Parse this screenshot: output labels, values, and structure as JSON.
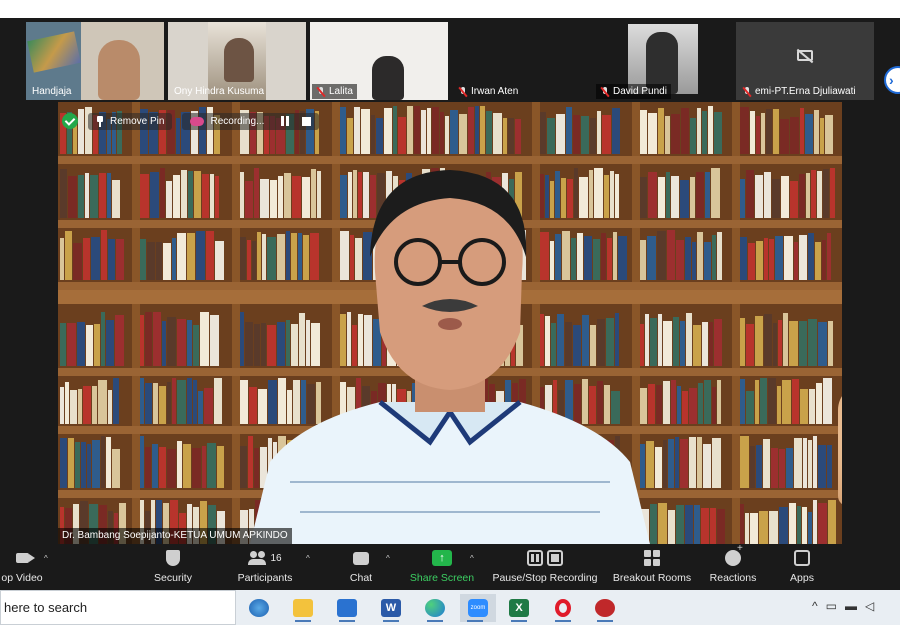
{
  "colors": {
    "zoom_bg": "#1a1a1a",
    "share_green": "#23b64b",
    "accent_blue": "#1f6ad6",
    "mute_red": "#e02828",
    "taskbar_bg": "#e9eef3"
  },
  "gallery": {
    "participants": [
      {
        "name": "Handjaja",
        "muted": false
      },
      {
        "name": "Ony Hindra Kusuma",
        "muted": false
      },
      {
        "name": "Lalita",
        "muted": true
      },
      {
        "name": "Irwan Aten",
        "muted": true
      },
      {
        "name": "David Pundi",
        "muted": true
      },
      {
        "name": "emi-PT.Erna Djuliawati",
        "muted": true,
        "video_off": true
      }
    ],
    "next_icon": "chevron-right-icon"
  },
  "overlay": {
    "remove_pin_label": "Remove Pin",
    "recording_label": "Recording..."
  },
  "speaker": {
    "name_tag": "Dr. Bambang Soepijanto-KETUA UMUM APKINDO"
  },
  "toolbar": {
    "stop_video": "op Video",
    "security": "Security",
    "participants": "Participants",
    "participants_count": "16",
    "chat": "Chat",
    "share_screen": "Share Screen",
    "pause_stop_recording": "Pause/Stop Recording",
    "breakout_rooms": "Breakout Rooms",
    "reactions": "Reactions",
    "apps": "Apps"
  },
  "taskbar": {
    "search_placeholder": "here to search",
    "apps": [
      "edge-legacy",
      "file-explorer",
      "mail",
      "word",
      "edge",
      "zoom",
      "excel",
      "opera",
      "other-app"
    ],
    "zoom_label": "zoom"
  }
}
